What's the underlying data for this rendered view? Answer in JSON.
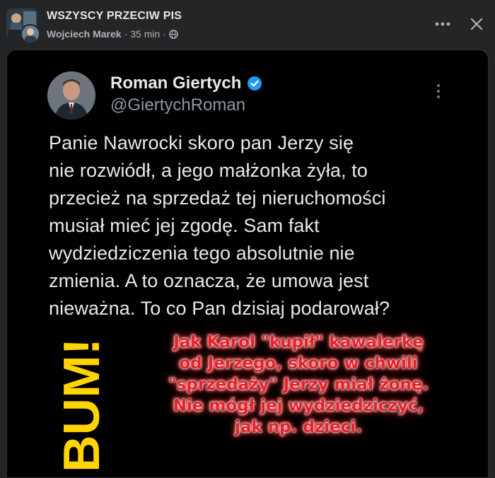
{
  "post": {
    "group_name": "WSZYSCY PRZECIW PIS",
    "author": "Wojciech Marek",
    "separator": "·",
    "time": "35 min",
    "privacy_icon": "globe-icon",
    "more_icon": "more-horizontal-icon",
    "close_icon": "close-icon"
  },
  "tweet": {
    "name": "Roman Giertych",
    "handle": "@GiertychRoman",
    "verified_color": "#1d9bf0",
    "text": "Panie Nawrocki skoro pan Jerzy się\nnie rozwiódł, a jego małżonka żyła, to\nprzecież na sprzedaż tej nieruchomości\nmusiał mieć jej zgodę. Sam fakt\nwydziedziczenia tego absolutnie nie\nzmienia. A to oznacza, że umowa jest\nnieważna. To co Pan dzisiaj podarował?"
  },
  "overlay": {
    "bum": "BUM!",
    "bum_color": "#ffd400",
    "red_text": "Jak Karol \"kupił\" kawalerkę\nod Jerzego, skoro w chwili\n\"sprzedaży\" Jerzy miał żonę.\nNie mógł jej wydziedziczyć,\njak np. dzieci.",
    "red_color": "#e8202a"
  },
  "colors": {
    "background": "#242526",
    "card_background": "#000000",
    "primary_text": "#e4e6eb",
    "secondary_text": "#b0b3b8"
  }
}
